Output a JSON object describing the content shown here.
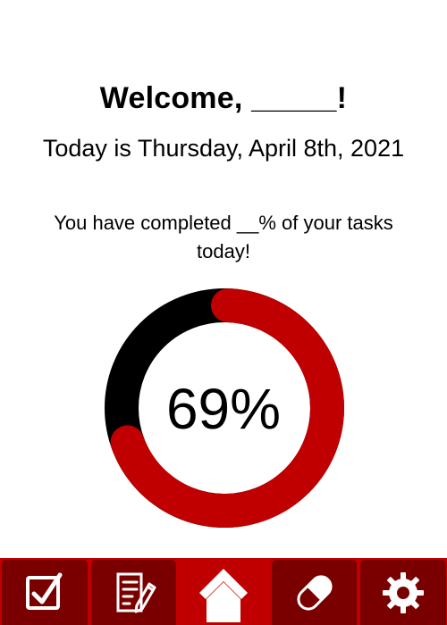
{
  "header": {
    "welcome": "Welcome, _____!",
    "date_line": "Today is Thursday, April 8th, 2021"
  },
  "progress": {
    "message": "You have completed __% of your tasks today!",
    "percent_label": "69%",
    "fraction": 0.69,
    "colors": {
      "completed": "#c00000",
      "remaining": "#000000"
    }
  },
  "nav": {
    "items": [
      {
        "name": "tasks",
        "icon": "checkbox-icon"
      },
      {
        "name": "notes",
        "icon": "edit-list-icon"
      },
      {
        "name": "home",
        "icon": "home-icon",
        "active": true
      },
      {
        "name": "medication",
        "icon": "pill-icon"
      },
      {
        "name": "settings",
        "icon": "gear-icon"
      }
    ],
    "colors": {
      "bar": "#c00000",
      "inactive": "#7a0000",
      "icon": "#ffffff"
    }
  }
}
